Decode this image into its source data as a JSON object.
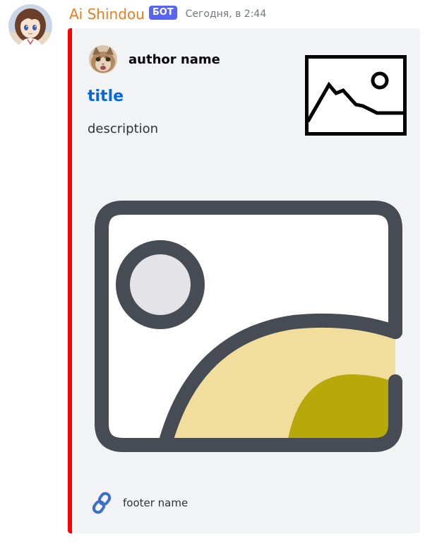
{
  "message": {
    "username": "Ai Shindou",
    "bot_tag": "БОТ",
    "timestamp": "Сегодня, в 2:44",
    "username_color": "#e67e22",
    "bot_tag_color": "#5865f2"
  },
  "embed": {
    "accent_color": "#ff0000",
    "author": {
      "name": "author name",
      "icon": "cat-face-icon"
    },
    "title": "title",
    "description": "description",
    "thumbnail": "image-placeholder-icon",
    "image": "image-placeholder-illustration",
    "footer": {
      "text": "footer name",
      "icon": "link-icon"
    }
  }
}
